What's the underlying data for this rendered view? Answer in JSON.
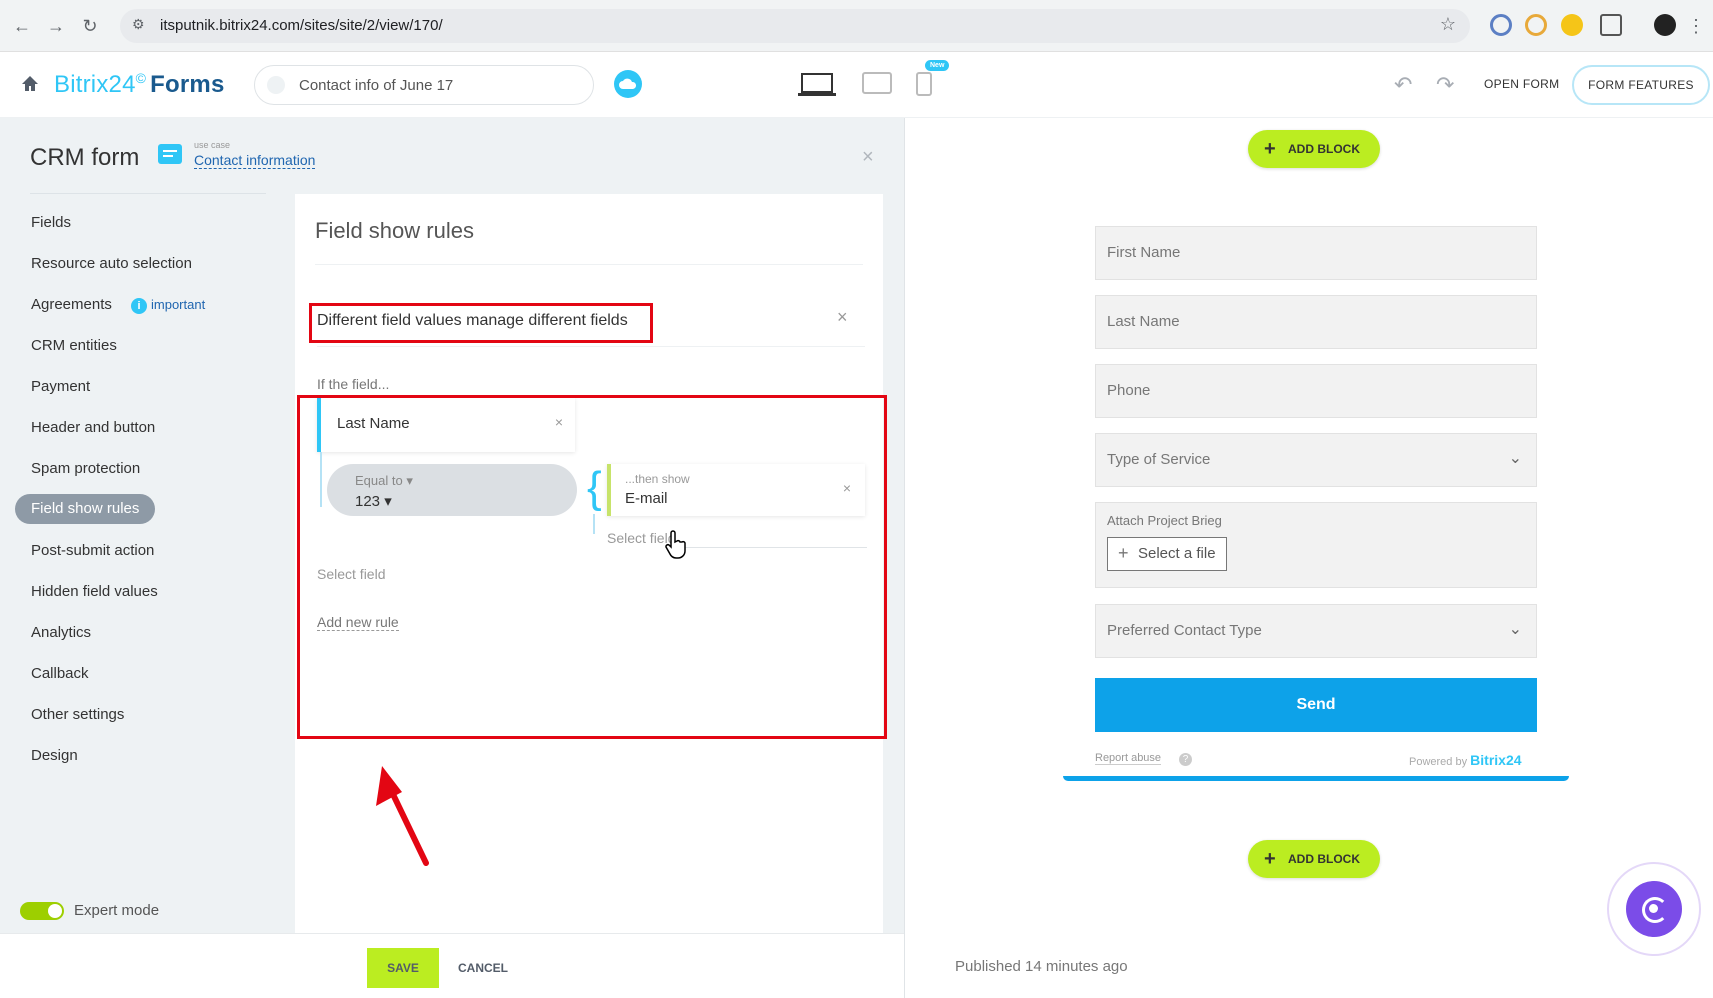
{
  "browser": {
    "url": "itsputnik.bitrix24.com/sites/site/2/view/170/"
  },
  "header": {
    "logo_brand": "Bitrix24",
    "logo_reg": "©",
    "logo_product": "Forms",
    "form_title": "Contact info of June 17",
    "new_badge": "New",
    "open_form_label": "OPEN FORM",
    "form_features_label": "FORM FEATURES"
  },
  "sidebar": {
    "title": "CRM form",
    "use_case_label": "use case",
    "use_case_value": "Contact information",
    "important_label": "important",
    "items": [
      {
        "label": "Fields"
      },
      {
        "label": "Resource auto selection"
      },
      {
        "label": "Agreements"
      },
      {
        "label": "CRM entities"
      },
      {
        "label": "Payment"
      },
      {
        "label": "Header and button"
      },
      {
        "label": "Spam protection"
      },
      {
        "label": "Field show rules",
        "active": true
      },
      {
        "label": "Post-submit action"
      },
      {
        "label": "Hidden field values"
      },
      {
        "label": "Analytics"
      },
      {
        "label": "Callback"
      },
      {
        "label": "Other settings"
      },
      {
        "label": "Design"
      }
    ],
    "expert_mode_label": "Expert mode",
    "expert_mode_on": true
  },
  "rules": {
    "title": "Field show rules",
    "rule_name": "Different field values manage different fields",
    "if_label": "If the field...",
    "condition_field": "Last Name",
    "operator": "Equal to",
    "operator_value": "123",
    "then_label": "...then show",
    "then_field": "E-mail",
    "select_field_then": "Select field",
    "select_field_if": "Select field",
    "add_rule": "Add new rule"
  },
  "footer": {
    "save": "SAVE",
    "cancel": "CANCEL"
  },
  "preview": {
    "add_block": "ADD BLOCK",
    "fields": {
      "first_name": "First Name",
      "last_name": "Last Name",
      "phone": "Phone",
      "type_of_service": "Type of Service",
      "attach_label": "Attach Project Brieg",
      "select_file": "Select a file",
      "preferred_contact": "Preferred Contact Type"
    },
    "send": "Send",
    "report_abuse": "Report abuse",
    "powered_by": "Powered by",
    "powered_brand": "Bitrix24",
    "published": "Published 14 minutes ago"
  },
  "colors": {
    "accent": "#2fc6f6",
    "save_green": "#bbed21",
    "send_blue": "#0da2e9",
    "highlight_red": "#e30613"
  }
}
